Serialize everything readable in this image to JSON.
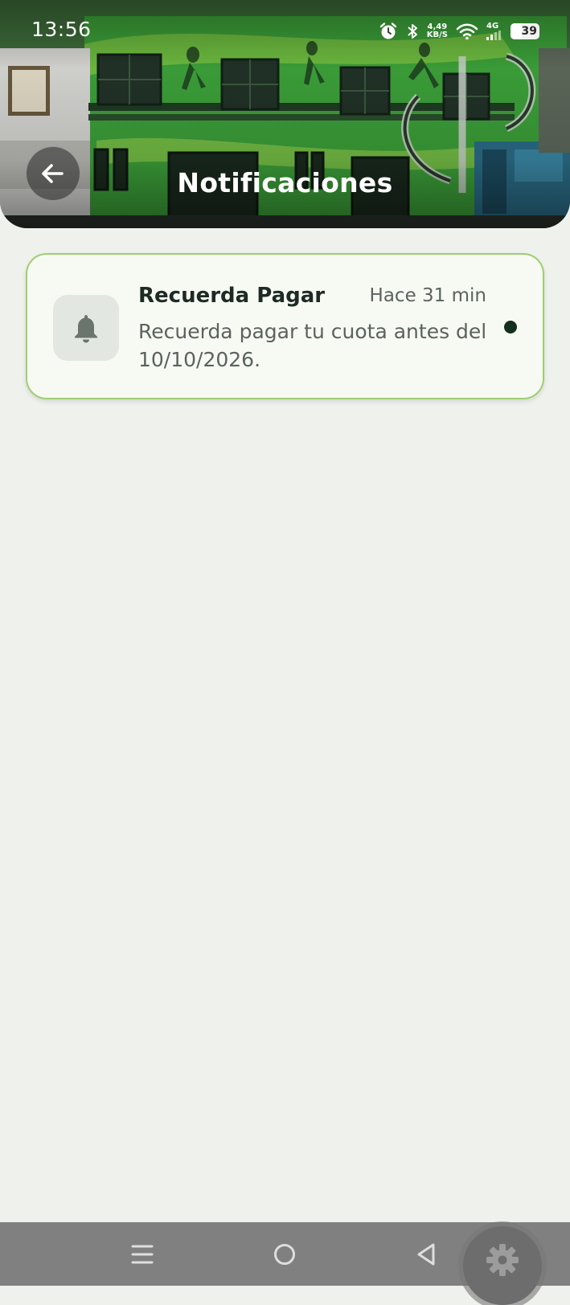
{
  "status_bar": {
    "time": "13:56",
    "speed_value": "4,49",
    "speed_unit": "KB/S",
    "network_type": "4G",
    "battery_level": "39"
  },
  "header": {
    "title": "Notificaciones"
  },
  "notifications": [
    {
      "title": "Recuerda Pagar",
      "time": "Hace 31 min",
      "body": "Recuerda pagar tu cuota antes del 10/10/2026.",
      "icon": "bell-icon",
      "unread": true
    }
  ],
  "colors": {
    "background": "#eef1ec",
    "card_background": "#f7faf3",
    "card_border": "#9fce72",
    "unread_dot": "#12301c",
    "nav_bar": "#808080"
  }
}
